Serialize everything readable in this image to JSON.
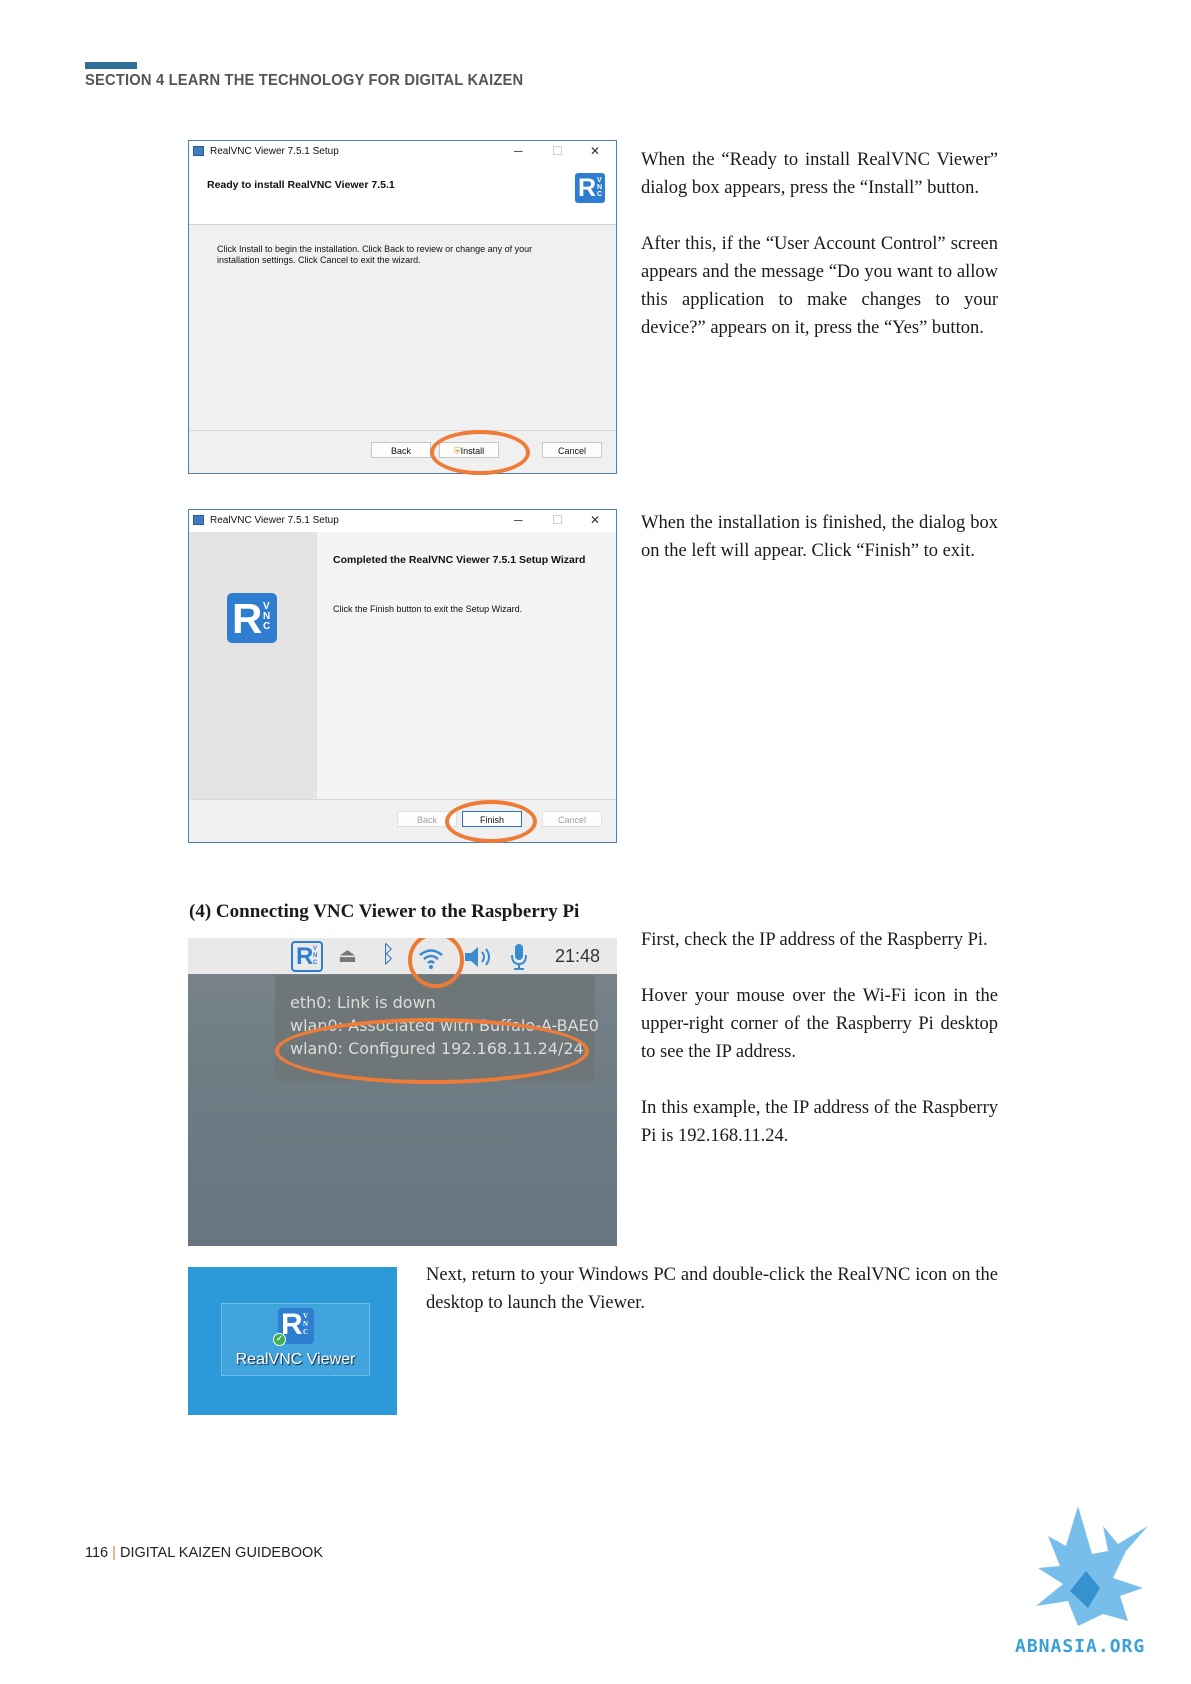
{
  "header": {
    "section_title": "SECTION 4  LEARN THE TECHNOLOGY FOR DIGITAL KAIZEN"
  },
  "dialog_install": {
    "window_title": "RealVNC Viewer 7.5.1 Setup",
    "heading": "Ready to install RealVNC Viewer 7.5.1",
    "body": "Click Install to begin the installation. Click Back to review or change any of your installation settings. Click Cancel to exit the wizard.",
    "back": "Back",
    "install": "Install",
    "cancel": "Cancel"
  },
  "text_install": [
    "When the “Ready to install RealVNC Viewer” dialog box appears, press the “Install” button.",
    "After this, if the “User Account Control” screen appears and the message “Do you want to allow this application to make changes to your device?” appears on it, press the “Yes” button."
  ],
  "dialog_finish": {
    "window_title": "RealVNC Viewer 7.5.1 Setup",
    "heading": "Completed the RealVNC Viewer 7.5.1 Setup Wizard",
    "body": "Click the Finish button to exit the Setup Wizard.",
    "back": "Back",
    "finish": "Finish",
    "cancel": "Cancel"
  },
  "text_finish": "When the installation is finished, the dialog box on the left will appear. Click “Finish” to exit.",
  "section_heading": "(4)   Connecting VNC Viewer to the Raspberry Pi",
  "pi_screen": {
    "clock": "21:48",
    "lines": [
      "eth0: Link is down",
      "wlan0: Associated with Buffalo-A-BAE0",
      "wlan0: Configured 192.168.11.24/24"
    ],
    "icons": [
      "realvnc-icon",
      "eject-icon",
      "bluetooth-icon",
      "wifi-icon",
      "volume-icon",
      "microphone-icon"
    ]
  },
  "text_ip": [
    "First, check the IP address of the Raspberry Pi.",
    "Hover your mouse over the Wi-Fi icon in the upper-right corner of the Raspberry Pi desktop to see the IP address.",
    "In this example, the IP address of the Raspberry Pi is 192.168.11.24."
  ],
  "desktop_icon": {
    "label": "RealVNC Viewer"
  },
  "text_launch": "Next, return to your Windows PC and double-click the RealVNC icon on the desktop to launch the Viewer.",
  "footer": {
    "page_number": "116",
    "book_title": "DIGITAL KAIZEN GUIDEBOOK"
  },
  "brand": "ABNASIA.ORG",
  "colors": {
    "accent_orange": "#ee7b36",
    "section_bar": "#2f6e95",
    "realvnc_blue": "#2f7dd1"
  }
}
